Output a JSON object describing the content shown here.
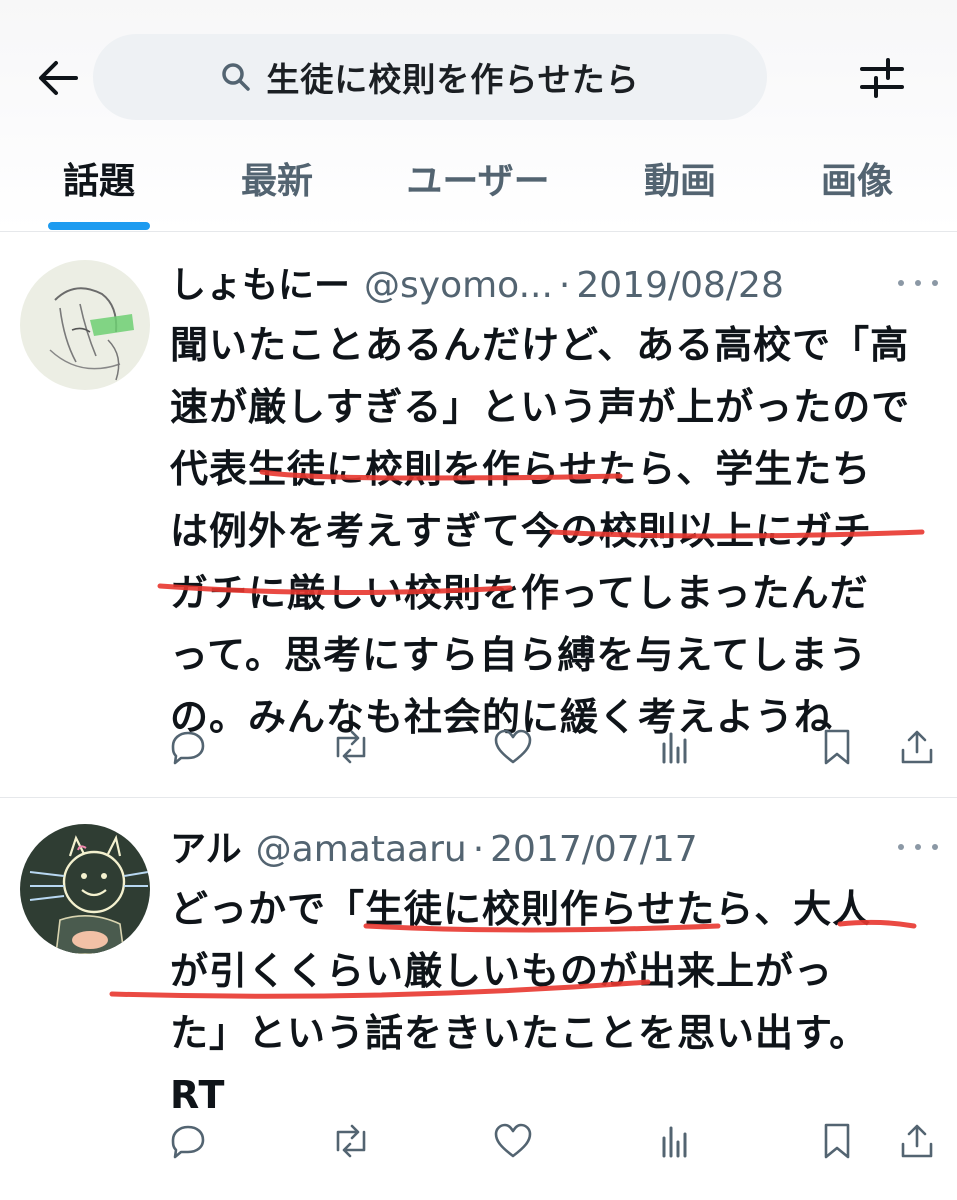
{
  "header": {
    "search_query": "生徒に校則を作らせたら",
    "back_icon": "arrow-left-icon",
    "filter_icon": "sliders-icon"
  },
  "tabs": [
    {
      "label": "話題",
      "active": true
    },
    {
      "label": "最新",
      "active": false
    },
    {
      "label": "ユーザー",
      "active": false
    },
    {
      "label": "動画",
      "active": false
    },
    {
      "label": "画像",
      "active": false
    }
  ],
  "tweets": [
    {
      "name": "しょもにー",
      "handle": "@syomo...",
      "separator": "·",
      "date": "2019/08/28",
      "lines": [
        "聞いたことあるんだけど、ある高校で「高",
        "速が厳しすぎる」という声が上がったので",
        "代表生徒に校則を作らせたら、学生たち",
        "は例外を考えすぎて今の校則以上にガチ",
        "ガチに厳しい校則を作ってしまったんだ",
        "って。思考にすら自ら縛を与えてしまう",
        "の。みんなも社会的に緩く考えようね"
      ]
    },
    {
      "name": "アル",
      "handle": "@amataaru",
      "separator": "·",
      "date": "2017/07/17",
      "lines": [
        "どっかで「生徒に校則作らせたら、大人",
        "が引くくらい厳しいものが出来上がっ",
        "た」という話をきいたことを思い出す。",
        "RT"
      ]
    }
  ],
  "actions": [
    "reply-icon",
    "retweet-icon",
    "like-icon",
    "views-icon",
    "bookmark-icon",
    "share-icon"
  ],
  "colors": {
    "accent": "#1d9bf0",
    "annotation_red": "#e8362f",
    "secondary_text": "#536471"
  }
}
